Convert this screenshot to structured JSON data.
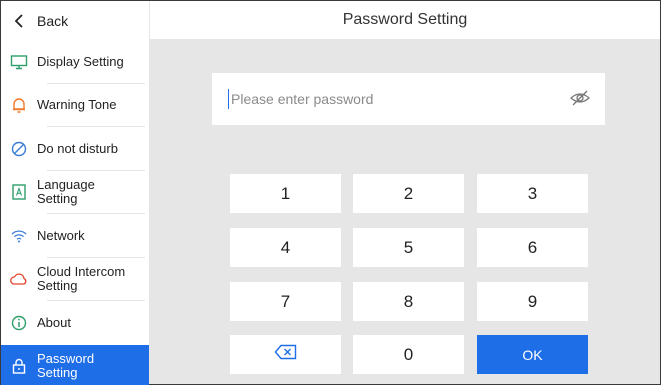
{
  "sidebar": {
    "back_label": "Back",
    "items": [
      {
        "label": "Display Setting",
        "icon": "monitor-icon"
      },
      {
        "label": "Warning Tone",
        "icon": "bell-icon"
      },
      {
        "label": "Do not disturb",
        "icon": "do-not-disturb-icon"
      },
      {
        "label": "Language Setting",
        "icon": "language-icon"
      },
      {
        "label": "Network",
        "icon": "wifi-icon"
      },
      {
        "label": "Cloud Intercom Setting",
        "icon": "cloud-icon"
      },
      {
        "label": "About",
        "icon": "info-icon"
      },
      {
        "label": "Password Setting",
        "icon": "lock-icon",
        "active": true
      }
    ]
  },
  "header": {
    "title": "Password Setting"
  },
  "password": {
    "placeholder": "Please enter password",
    "value": ""
  },
  "keypad": {
    "keys": [
      "1",
      "2",
      "3",
      "4",
      "5",
      "6",
      "7",
      "8",
      "9",
      "backspace",
      "0",
      "OK"
    ],
    "ok_label": "OK"
  },
  "colors": {
    "accent": "#1e6ee8",
    "icon_green": "#2e9e6a",
    "icon_orange": "#f07a2a",
    "icon_blue": "#3a7bd5",
    "icon_red": "#e0442c",
    "main_bg": "#e6e6e6"
  }
}
